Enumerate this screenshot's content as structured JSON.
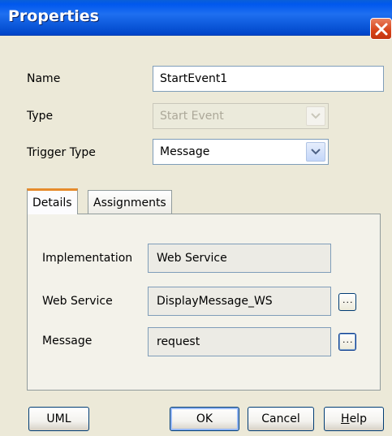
{
  "window": {
    "title": "Properties"
  },
  "form": {
    "name_label": "Name",
    "name_value": "StartEvent1",
    "type_label": "Type",
    "type_value": "Start Event",
    "trigger_label": "Trigger Type",
    "trigger_value": "Message"
  },
  "tabs": [
    {
      "label": "Details",
      "active": true
    },
    {
      "label": "Assignments",
      "active": false
    }
  ],
  "details": {
    "implementation_label": "Implementation",
    "implementation_value": "Web Service",
    "web_service_label": "Web Service",
    "web_service_value": "DisplayMessage_WS",
    "message_label": "Message",
    "message_value": "request",
    "browse_label": "..."
  },
  "buttons": {
    "uml": "UML",
    "ok": "OK",
    "cancel": "Cancel",
    "help_first": "H",
    "help_rest": "elp"
  },
  "colors": {
    "titlebar": "#0058ee",
    "dialog_bg": "#ece9d8",
    "active_tab_accent": "#e68b2c",
    "close_button": "#d64218"
  }
}
